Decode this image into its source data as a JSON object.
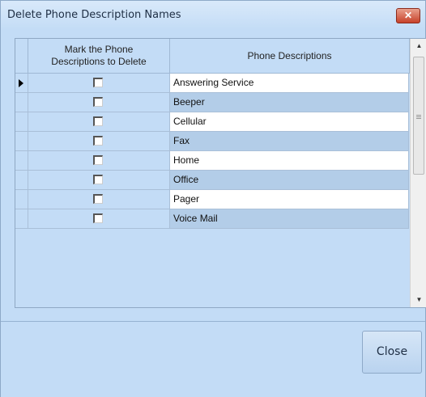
{
  "window": {
    "title": "Delete Phone Description Names",
    "close_glyph": "✕"
  },
  "grid": {
    "columns": [
      "Mark the Phone Descriptions to Delete",
      "Phone Descriptions"
    ],
    "rows": [
      {
        "label": "Answering Service",
        "checked": false,
        "current": true
      },
      {
        "label": "Beeper",
        "checked": false,
        "current": false
      },
      {
        "label": "Cellular",
        "checked": false,
        "current": false
      },
      {
        "label": "Fax",
        "checked": false,
        "current": false
      },
      {
        "label": "Home",
        "checked": false,
        "current": false
      },
      {
        "label": "Office",
        "checked": false,
        "current": false
      },
      {
        "label": "Pager",
        "checked": false,
        "current": false
      },
      {
        "label": "Voice Mail",
        "checked": false,
        "current": false
      }
    ]
  },
  "scrollbar": {
    "up_glyph": "▲",
    "down_glyph": "▼"
  },
  "buttons": {
    "close_label": "Close"
  }
}
